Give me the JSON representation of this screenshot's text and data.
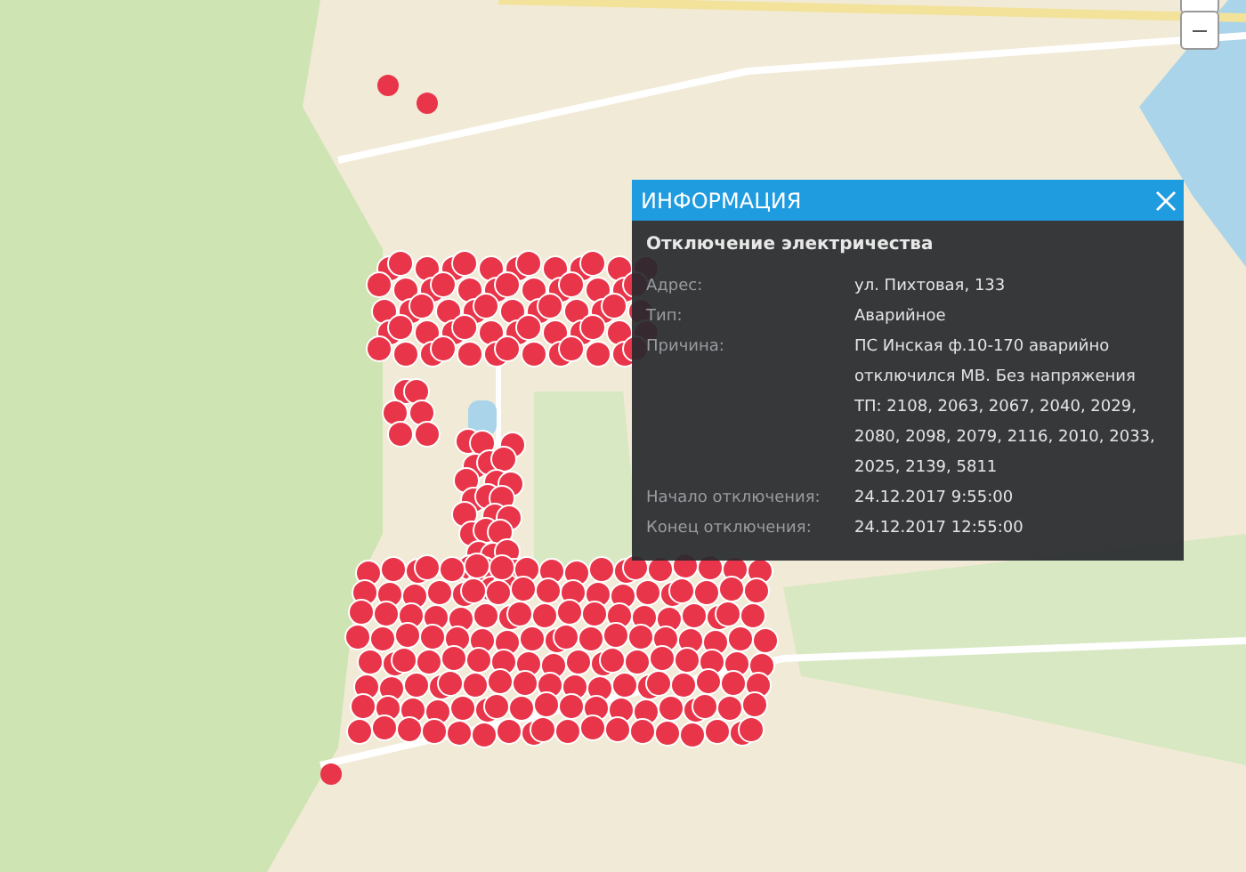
{
  "popup": {
    "title": "ИНФОРМАЦИЯ",
    "heading": "Отключение электричества",
    "fields": [
      {
        "label": "Адрес:",
        "value": "ул. Пихтовая, 133"
      },
      {
        "label": "Тип:",
        "value": "Аварийное"
      },
      {
        "label": "Причина:",
        "value": "ПС Инская ф.10-170 аварийно отключился МВ. Без напряжения ТП: 2108, 2063, 2067, 2040, 2029, 2080, 2098, 2079, 2116, 2010, 2033, 2025, 2139, 5811"
      },
      {
        "label": "Начало отключения:",
        "value": "24.12.2017 9:55:00"
      },
      {
        "label": "Конец отключения:",
        "value": "24.12.2017 12:55:00"
      }
    ]
  }
}
